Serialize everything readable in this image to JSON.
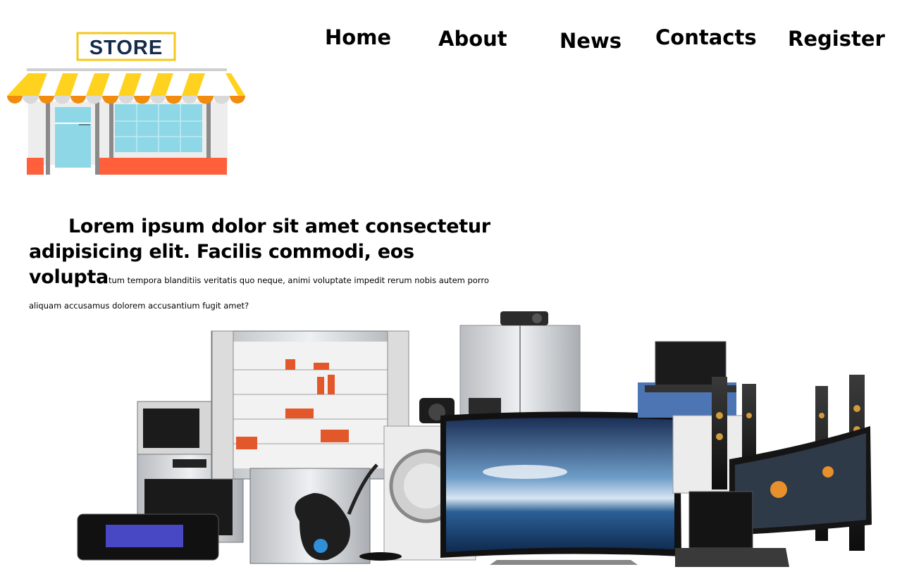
{
  "logo": {
    "sign_text": "STORE"
  },
  "nav": {
    "items": [
      {
        "label": "Home"
      },
      {
        "label": "About"
      },
      {
        "label": "News"
      },
      {
        "label": "Contacts"
      },
      {
        "label": "Register"
      }
    ]
  },
  "hero": {
    "heading": "Lorem ipsum dolor sit amet consectetur adipisicing elit. Facilis commodi, eos volupta",
    "rest": "tum tempora blanditiis veritatis quo neque, animi voluptate impedit rerum nobis autem porro aliquam accusamus dolorem accusantium fugit amet?"
  },
  "colors": {
    "awning_yellow": "#FFD21F",
    "awning_orange": "#F28C0F",
    "window_blue": "#8ED7E6",
    "store_base": "#FF5F3A",
    "sign_text": "#142B4C"
  }
}
